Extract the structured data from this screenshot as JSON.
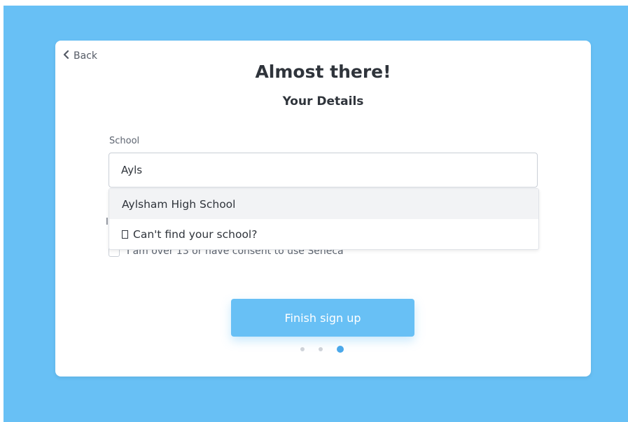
{
  "nav": {
    "back_label": "Back"
  },
  "header": {
    "title": "Almost there!",
    "subtitle": "Your Details"
  },
  "school_field": {
    "label": "School",
    "value": "Ayls"
  },
  "school_dropdown": {
    "options": [
      "Aylsham High School",
      "Can't find your school?"
    ]
  },
  "obscured_label_fragment": "I",
  "consent": {
    "label": "I am over 13 or have consent to use Seneca",
    "checked": false
  },
  "finish_button": {
    "label": "Finish sign up"
  },
  "progress": {
    "total_steps": 3,
    "current_step": 3
  },
  "colors": {
    "background": "#68c0f5",
    "button": "#68c0f5",
    "active_dot": "#4aa8ea",
    "text": "#2f343b"
  }
}
